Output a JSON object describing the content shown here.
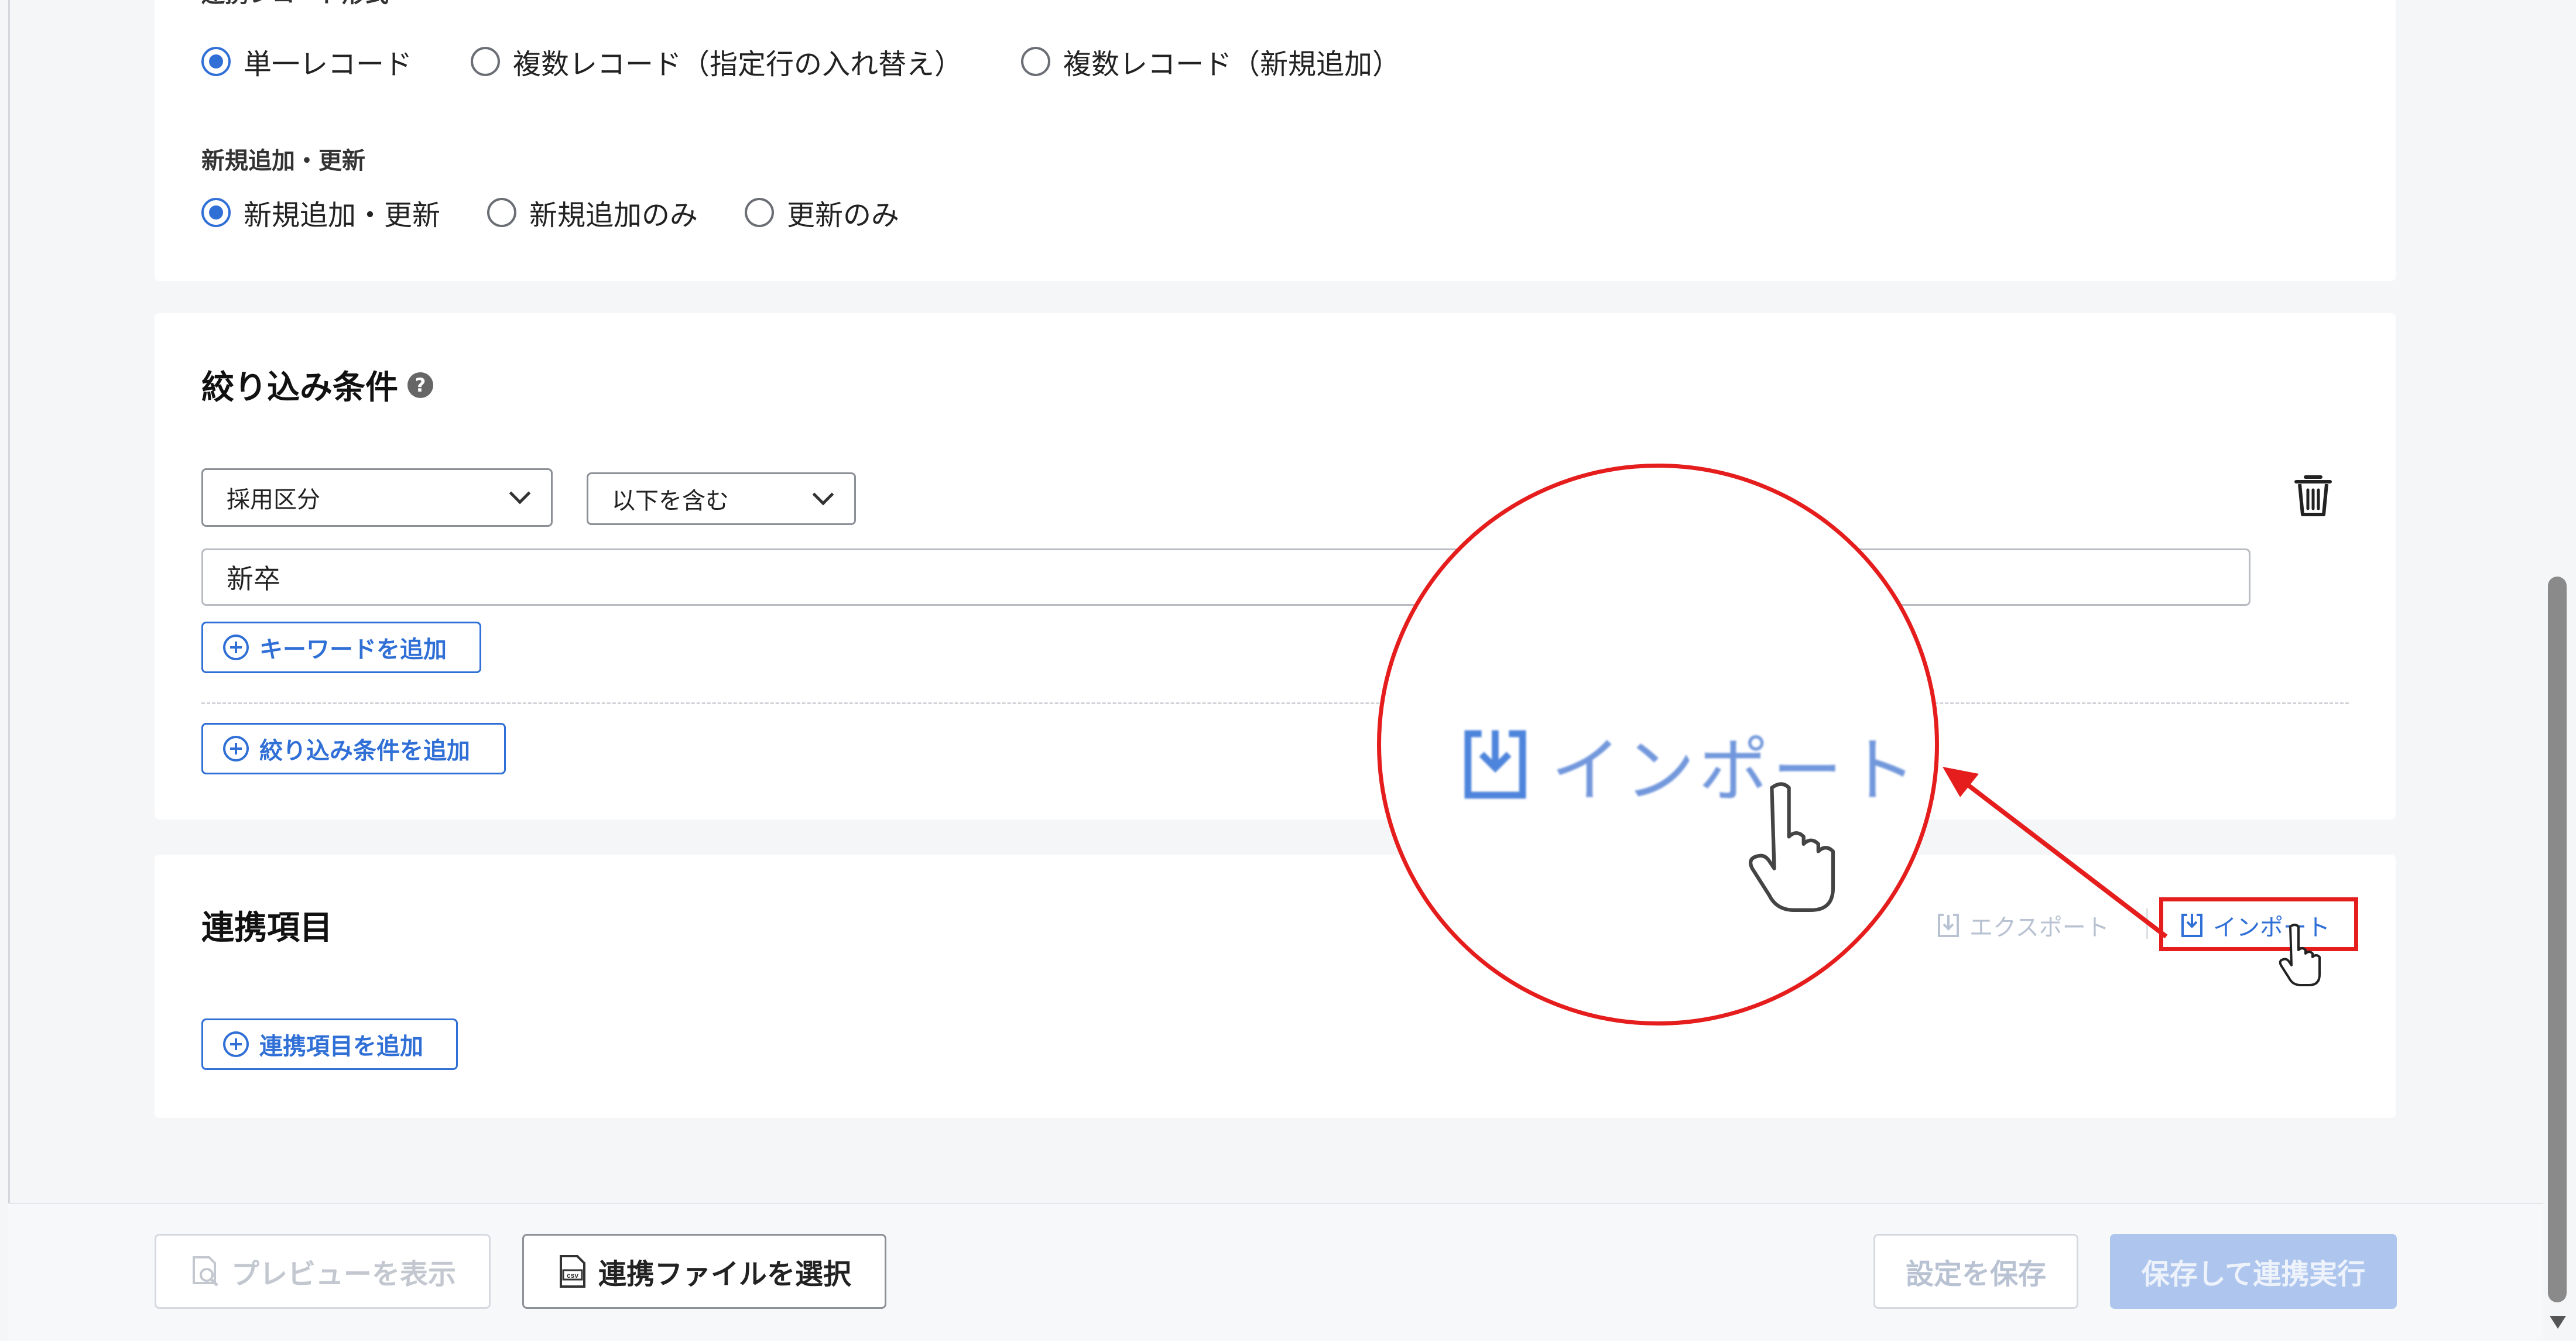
{
  "record_format": {
    "label": "連携レコード形式",
    "options": [
      "単一レコード",
      "複数レコード（指定行の入れ替え）",
      "複数レコード（新規追加）"
    ],
    "selected": 0
  },
  "upsert": {
    "label": "新規追加・更新",
    "options": [
      "新規追加・更新",
      "新規追加のみ",
      "更新のみ"
    ],
    "selected": 0
  },
  "filter": {
    "title": "絞り込み条件",
    "help_icon": "?",
    "field_select": "採用区分",
    "operator_select": "以下を含む",
    "keyword_value": "新卒",
    "add_keyword": "キーワードを追加",
    "add_condition": "絞り込み条件を追加"
  },
  "fields": {
    "title": "連携項目",
    "export_label": "エクスポート",
    "import_label": "インポート",
    "add_field": "連携項目を追加"
  },
  "zoom": {
    "import_label": "インポート"
  },
  "footer": {
    "preview": "プレビューを表示",
    "select_file": "連携ファイルを選択",
    "save_settings": "設定を保存",
    "save_and_run": "保存して連携実行"
  },
  "colors": {
    "accent": "#2f6fd6",
    "disabled_text": "#b8c2d2",
    "primary_disabled_bg": "#aec6ee",
    "annotation_red": "#e51d1d"
  }
}
